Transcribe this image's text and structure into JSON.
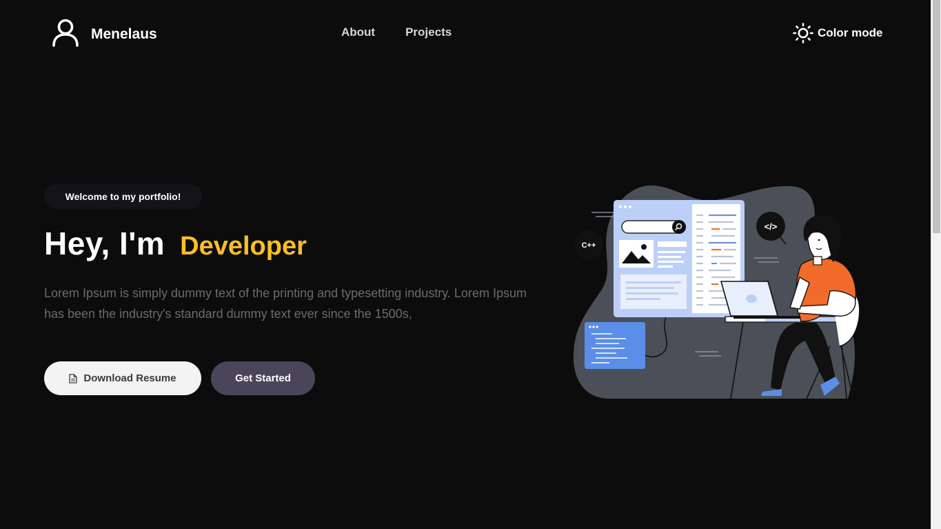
{
  "nav": {
    "brand_name": "Menelaus",
    "links": [
      {
        "label": "About"
      },
      {
        "label": "Projects"
      }
    ],
    "color_mode_label": "Color mode"
  },
  "hero": {
    "badge": "Welcome to my portfolio!",
    "headline": "Hey, I'm",
    "headline_accent": "Developer",
    "description": "Lorem Ipsum is simply dummy text of the printing and typesetting industry. Lorem Ipsum has been the industry's standard dummy text ever since the 1500s,",
    "download_label": "Download Resume",
    "start_label": "Get Started"
  },
  "illustration": {
    "cpp_label": "C++",
    "code_label": "</>"
  },
  "colors": {
    "background": "#0c0c0d",
    "accent": "#fbbf24",
    "button_secondary": "#4a4558",
    "button_primary": "#f3f3f3",
    "illustration_blob": "#4b4f57",
    "illustration_panel": "#bcd0f7",
    "shirt": "#f26b2b"
  },
  "icons": {
    "brand": "user-icon",
    "color_mode": "sun-icon",
    "resume": "document-icon"
  }
}
